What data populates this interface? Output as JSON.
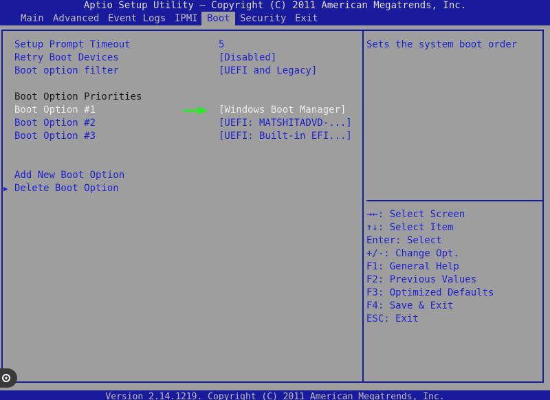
{
  "title": "Aptio Setup Utility – Copyright (C) 2011 American Megatrends, Inc.",
  "menu": {
    "tabs": [
      "Main",
      "Advanced",
      "Event Logs",
      "IPMI",
      "Boot",
      "Security",
      "Exit"
    ],
    "active": "Boot"
  },
  "settings": {
    "setup_prompt_timeout": {
      "label": "Setup Prompt Timeout",
      "value": "5"
    },
    "retry_boot_devices": {
      "label": "Retry Boot Devices",
      "value": "[Disabled]"
    },
    "boot_option_filter": {
      "label": "Boot option filter",
      "value": "[UEFI and Legacy]"
    },
    "priorities_heading": "Boot Option Priorities",
    "boot_options": [
      {
        "label": "Boot Option #1",
        "value": "[Windows Boot Manager]"
      },
      {
        "label": "Boot Option #2",
        "value": "[UEFI: MATSHITADVD-...]"
      },
      {
        "label": "Boot Option #3",
        "value": "[UEFI: Built-in EFI...]"
      }
    ],
    "add_new_boot_option": "Add New Boot Option",
    "delete_boot_option": "Delete Boot Option"
  },
  "help": {
    "description": "Sets the system boot order",
    "keys": [
      "→←: Select Screen",
      "↑↓: Select Item",
      "Enter: Select",
      "+/-: Change Opt.",
      "F1: General Help",
      "F2: Previous Values",
      "F3: Optimized Defaults",
      "F4: Save & Exit",
      "ESC: Exit"
    ]
  },
  "footer": "Version 2.14.1219. Copyright (C) 2011 American Megatrends, Inc.",
  "colors": {
    "bar": "#1a1a9c",
    "background": "#9e9e9e",
    "item_text": "#1f1fd0",
    "selected_text": "#eaeaea",
    "annotation_arrow": "#22ee22"
  },
  "icons": {
    "submenu_marker": "triangle-right-icon",
    "annotation": "green-arrow-icon",
    "lens": "google-lens-icon"
  }
}
